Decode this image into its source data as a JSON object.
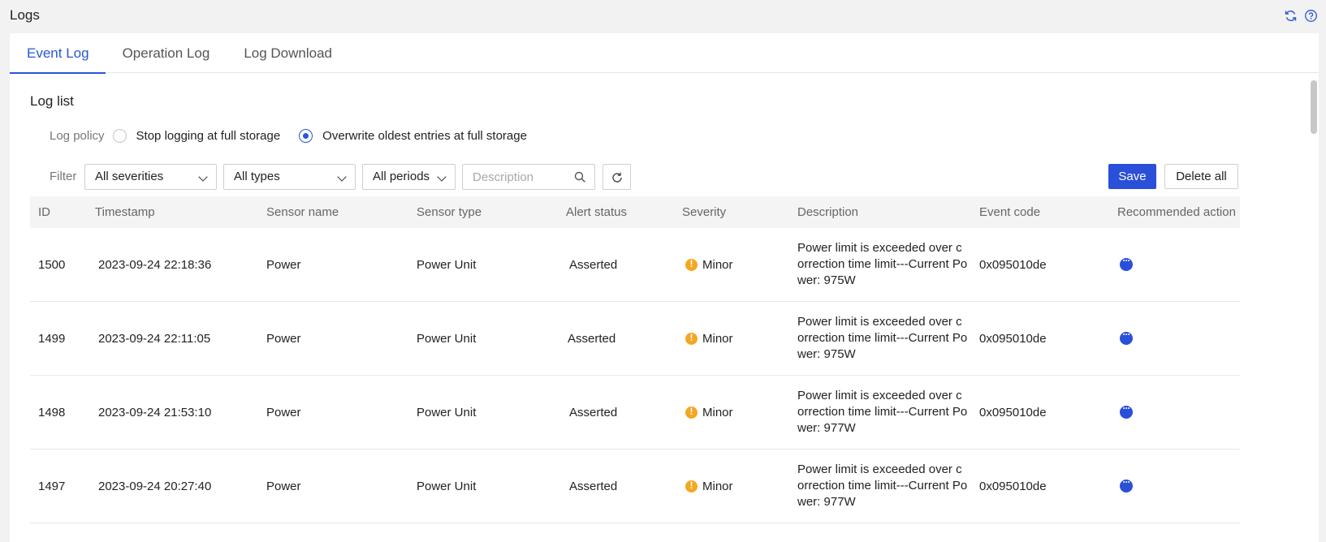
{
  "page": {
    "title": "Logs"
  },
  "tabs": [
    {
      "label": "Event Log",
      "active": true
    },
    {
      "label": "Operation Log",
      "active": false
    },
    {
      "label": "Log Download",
      "active": false
    }
  ],
  "section_title": "Log list",
  "policy": {
    "label": "Log policy",
    "options": [
      {
        "label": "Stop logging at full storage",
        "selected": false
      },
      {
        "label": "Overwrite oldest entries at full storage",
        "selected": true
      }
    ]
  },
  "filter": {
    "label": "Filter",
    "severity": "All severities",
    "type": "All types",
    "period": "All periods",
    "search_placeholder": "Description",
    "save_label": "Save",
    "delete_all_label": "Delete all"
  },
  "table": {
    "columns": [
      "ID",
      "Timestamp",
      "Sensor name",
      "Sensor type",
      "Alert status",
      "Severity",
      "Description",
      "Event code",
      "Recommended action"
    ],
    "rows": [
      {
        "id": "1500",
        "timestamp": "2023-09-24 22:18:36",
        "sensor_name": "Power",
        "sensor_type": "Power Unit",
        "alert_status": "Asserted",
        "severity": "Minor",
        "description": "Power limit is exceeded over correction time limit---Current Power: 975W",
        "event_code": "0x095010de"
      },
      {
        "id": "1499",
        "timestamp": "2023-09-24 22:11:05",
        "sensor_name": "Power",
        "sensor_type": "Power Unit",
        "alert_status": "Asserted",
        "severity": "Minor",
        "description": "Power limit is exceeded over correction time limit---Current Power: 975W",
        "event_code": "0x095010de"
      },
      {
        "id": "1498",
        "timestamp": "2023-09-24 21:53:10",
        "sensor_name": "Power",
        "sensor_type": "Power Unit",
        "alert_status": "Asserted",
        "severity": "Minor",
        "description": "Power limit is exceeded over correction time limit---Current Power: 977W",
        "event_code": "0x095010de"
      },
      {
        "id": "1497",
        "timestamp": "2023-09-24 20:27:40",
        "sensor_name": "Power",
        "sensor_type": "Power Unit",
        "alert_status": "Asserted",
        "severity": "Minor",
        "description": "Power limit is exceeded over correction time limit---Current Power: 977W",
        "event_code": "0x095010de"
      }
    ]
  },
  "colors": {
    "accent": "#2a4fd8",
    "minor": "#f5a623"
  }
}
